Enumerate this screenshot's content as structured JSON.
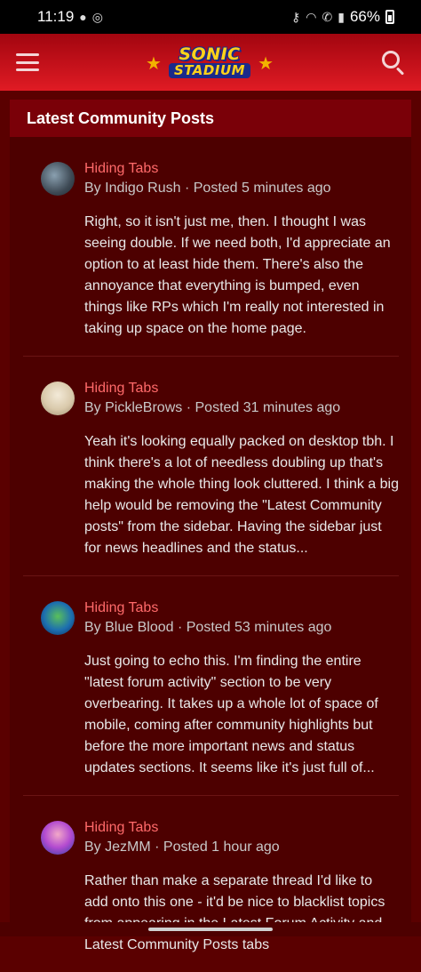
{
  "status_bar": {
    "time": "11:19",
    "battery": "66%"
  },
  "header": {
    "logo_line1": "SONIC",
    "logo_line2": "STADIUM"
  },
  "widget": {
    "title": "Latest Community Posts"
  },
  "posts": [
    {
      "title": "Hiding Tabs",
      "by": "By",
      "author": "Indigo Rush",
      "posted": "· Posted 5 minutes ago",
      "text": "Right, so it isn't just me, then. I thought I was seeing double. If we need both, I'd appreciate an option to at least hide them. There's also the annoyance that everything is bumped, even things like RPs which I'm really not interested in taking up space on the home page."
    },
    {
      "title": "Hiding Tabs",
      "by": "By",
      "author": "PickleBrows",
      "posted": "· Posted 31 minutes ago",
      "text": "Yeah it's looking equally packed on desktop tbh. I think there's a lot of needless doubling up that's making the whole thing look cluttered. I think a big help would be removing the  \"Latest Community posts\" from the sidebar. Having the sidebar just for news headlines and the status..."
    },
    {
      "title": "Hiding Tabs",
      "by": "By",
      "author": "Blue Blood",
      "posted": "· Posted 53 minutes ago",
      "text": "Just going to echo this. I'm finding the entire \"latest forum activity\" section to be very overbearing. It takes up a whole lot of space of mobile, coming after community highlights but before the more important news and status updates sections. It seems like it's just full of..."
    },
    {
      "title": "Hiding Tabs",
      "by": "By",
      "author": "JezMM",
      "posted": "· Posted 1 hour ago",
      "text": "Rather than make a separate thread I'd like to add onto this one - it'd be nice to blacklist topics from appearing in the Latest Forum Activity and Latest Community Posts tabs"
    }
  ],
  "colors": {
    "header_red": "#e01b24",
    "background": "#5a0000",
    "title_link": "#ff6a6a"
  }
}
